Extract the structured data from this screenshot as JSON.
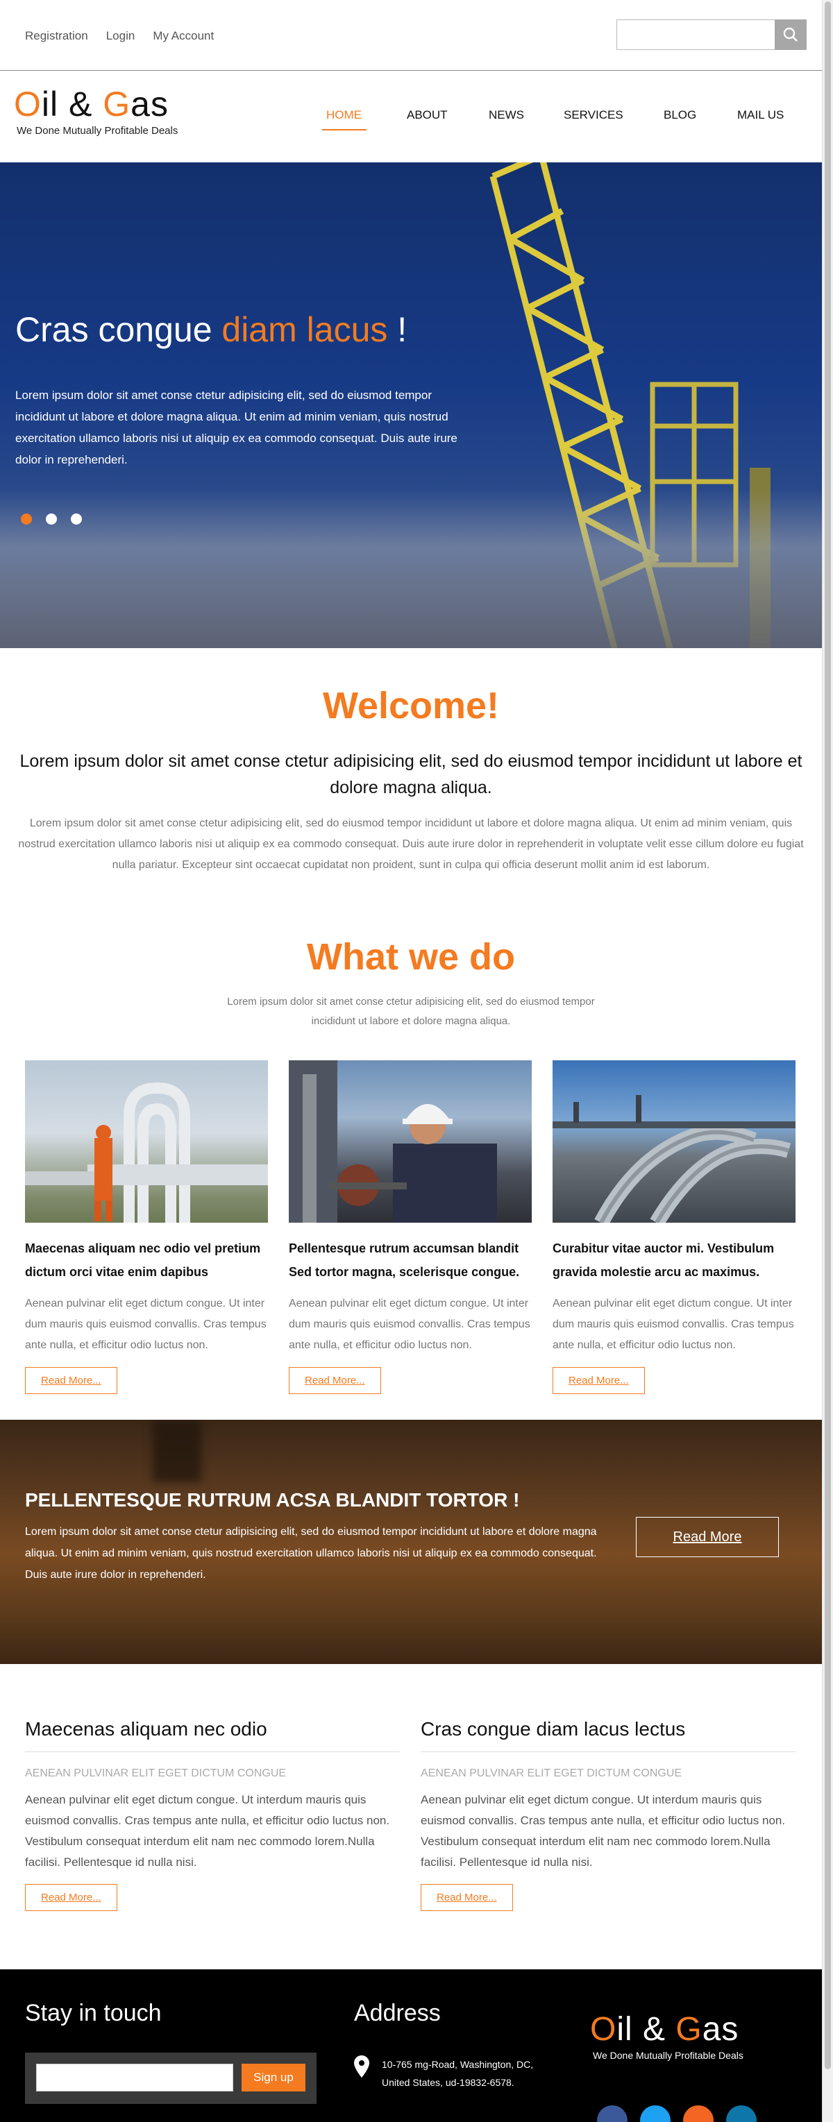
{
  "topbar": {
    "links": [
      "Registration",
      "Login",
      "My Account"
    ],
    "search_placeholder": ""
  },
  "logo": {
    "first": "O",
    "rest1": "il & ",
    "g": "G",
    "rest2": "as",
    "tagline": "We Done Mutually Profitable Deals"
  },
  "nav": {
    "items": [
      "HOME",
      "ABOUT",
      "NEWS",
      "SERVICES",
      "BLOG",
      "MAIL US"
    ],
    "active": "HOME"
  },
  "hero": {
    "title_start": "Cras congue ",
    "title_highlight": "diam lacus",
    "title_end": " !",
    "text": "Lorem ipsum dolor sit amet conse ctetur adipisicing elit, sed do eiusmod tempor incididunt ut labore et dolore magna aliqua. Ut enim ad minim veniam, quis nostrud exercitation ullamco laboris nisi ut aliquip ex ea commodo consequat. Duis aute irure dolor in reprehenderi."
  },
  "welcome": {
    "title": "Welcome!",
    "lead": "Lorem ipsum dolor sit amet conse ctetur adipisicing elit, sed do eiusmod tempor incididunt ut labore et dolore magna aliqua.",
    "text": "Lorem ipsum dolor sit amet conse ctetur adipisicing elit, sed do eiusmod tempor incididunt ut labore et dolore magna aliqua. Ut enim ad minim veniam, quis nostrud exercitation ullamco laboris nisi ut aliquip ex ea commodo consequat. Duis aute irure dolor in reprehenderit in voluptate velit esse cillum dolore eu fugiat nulla pariatur. Excepteur sint occaecat cupidatat non proident, sunt in culpa qui officia deserunt mollit anim id est laborum."
  },
  "whatwedo": {
    "title": "What we do",
    "subtitle": "Lorem ipsum dolor sit amet conse ctetur adipisicing elit, sed do eiusmod tempor incididunt ut labore et dolore magna aliqua.",
    "cards": [
      {
        "title": "Maecenas aliquam nec odio vel pretium dictum orci vitae enim dapibus",
        "text": "Aenean pulvinar elit eget dictum congue. Ut inter dum mauris quis euismod convallis. Cras tempus ante nulla, et efficitur odio luctus non.",
        "button": "Read More..."
      },
      {
        "title": "Pellentesque rutrum accumsan blandit Sed tortor magna, scelerisque congue.",
        "text": "Aenean pulvinar elit eget dictum congue. Ut inter dum mauris quis euismod convallis. Cras tempus ante nulla, et efficitur odio luctus non.",
        "button": "Read More..."
      },
      {
        "title": "Curabitur vitae auctor mi. Vestibulum gravida molestie arcu ac maximus.",
        "text": "Aenean pulvinar elit eget dictum congue. Ut inter dum mauris quis euismod convallis. Cras tempus ante nulla, et efficitur odio luctus non.",
        "button": "Read More..."
      }
    ]
  },
  "banner": {
    "title": "PELLENTESQUE RUTRUM ACSA BLANDIT TORTOR !",
    "text": "Lorem ipsum dolor sit amet conse ctetur adipisicing elit, sed do eiusmod tempor incididunt ut labore et dolore magna aliqua. Ut enim ad minim veniam, quis nostrud exercitation ullamco laboris nisi ut aliquip ex ea commodo consequat. Duis aute irure dolor in reprehenderi.",
    "button": "Read More"
  },
  "columns": [
    {
      "title": "Maecenas aliquam nec odio",
      "small": "AENEAN PULVINAR ELIT EGET DICTUM CONGUE",
      "text": "Aenean pulvinar elit eget dictum congue. Ut interdum mauris quis euismod convallis. Cras tempus ante nulla, et efficitur odio luctus non. Vestibulum consequat interdum elit nam nec commodo lorem.Nulla facilisi. Pellentesque id nulla nisi.",
      "button": "Read More..."
    },
    {
      "title": "Cras congue diam lacus lectus",
      "small": "AENEAN PULVINAR ELIT EGET DICTUM CONGUE",
      "text": "Aenean pulvinar elit eget dictum congue. Ut interdum mauris quis euismod convallis. Cras tempus ante nulla, et efficitur odio luctus non. Vestibulum consequat interdum elit nam nec commodo lorem.Nulla facilisi. Pellentesque id nulla nisi.",
      "button": "Read More..."
    }
  ],
  "footer": {
    "stay_title": "Stay in touch",
    "signup_button": "Sign up",
    "address_title": "Address",
    "address_text": "10-765 mg-Road, Washington, DC, United States, ud-19832-6578.",
    "socials": [
      "facebook-icon",
      "twitter-icon",
      "rss-icon",
      "linkedin-icon"
    ]
  },
  "colors": {
    "accent": "#f47b20",
    "hero_blue": "#173a86",
    "footer_bg": "#000000"
  }
}
